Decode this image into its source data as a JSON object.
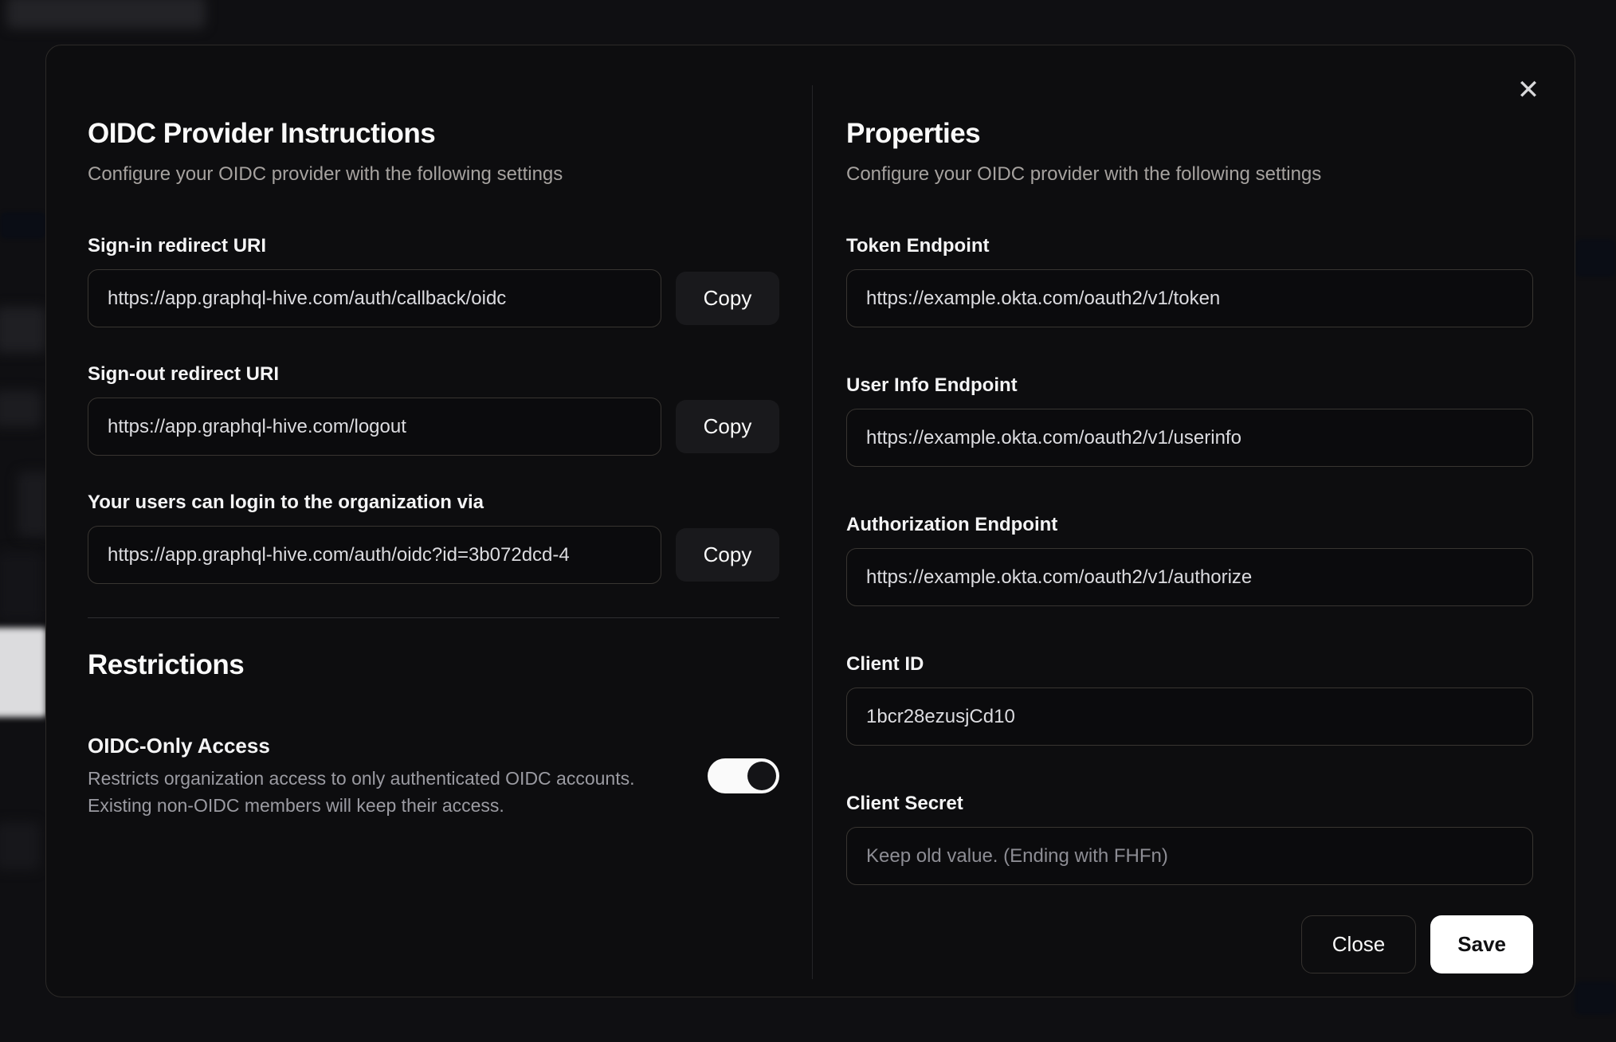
{
  "modal": {
    "close_icon": "✕",
    "left": {
      "title": "OIDC Provider Instructions",
      "subtitle": "Configure your OIDC provider with the following settings",
      "fields": [
        {
          "label": "Sign-in redirect URI",
          "value": "https://app.graphql-hive.com/auth/callback/oidc",
          "copy_label": "Copy"
        },
        {
          "label": "Sign-out redirect URI",
          "value": "https://app.graphql-hive.com/logout",
          "copy_label": "Copy"
        },
        {
          "label": "Your users can login to the organization via",
          "value": "https://app.graphql-hive.com/auth/oidc?id=3b072dcd-4",
          "copy_label": "Copy"
        }
      ],
      "restrictions": {
        "title": "Restrictions",
        "toggle_label": "OIDC-Only Access",
        "description_line1": "Restricts organization access to only authenticated OIDC accounts.",
        "description_line2": "Existing non-OIDC members will keep their access.",
        "toggle_state": "on"
      }
    },
    "right": {
      "title": "Properties",
      "subtitle": "Configure your OIDC provider with the following settings",
      "fields": [
        {
          "label": "Token Endpoint",
          "value": "https://example.okta.com/oauth2/v1/token"
        },
        {
          "label": "User Info Endpoint",
          "value": "https://example.okta.com/oauth2/v1/userinfo"
        },
        {
          "label": "Authorization Endpoint",
          "value": "https://example.okta.com/oauth2/v1/authorize"
        },
        {
          "label": "Client ID",
          "value": "1bcr28ezusjCd10"
        },
        {
          "label": "Client Secret",
          "value": "",
          "placeholder": "Keep old value. (Ending with FHFn)"
        }
      ],
      "buttons": {
        "close": "Close",
        "save": "Save"
      }
    }
  },
  "colors": {
    "modal_background": "#0d0d0f",
    "page_background": "#0f0f12",
    "input_border": "#383531",
    "accent_button": "#ffffff",
    "muted_text": "#a6a29f"
  }
}
